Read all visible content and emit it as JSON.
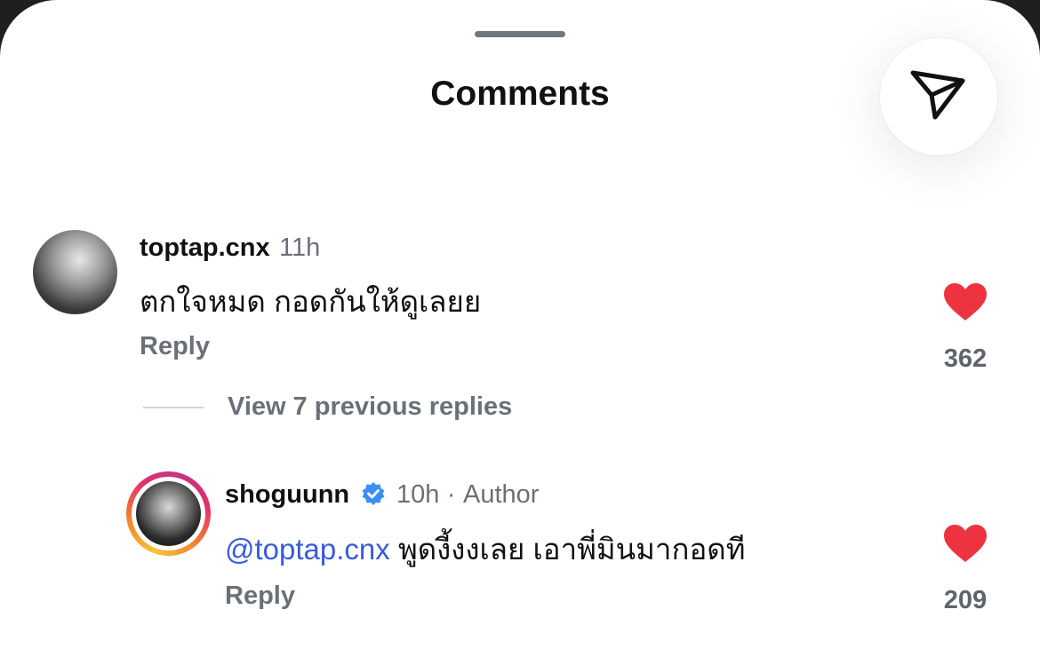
{
  "header": {
    "title": "Comments"
  },
  "share_button": {
    "icon": "paper-plane-icon"
  },
  "comments": [
    {
      "username": "toptap.cnx",
      "time": "11h",
      "text": "ตกใจหมด กอดกันให้ดูเลยย",
      "reply_label": "Reply",
      "likes": "362"
    },
    {
      "username": "shoguunn",
      "verified": true,
      "time": "10h",
      "separator": "·",
      "role": "Author",
      "mention": "@toptap.cnx",
      "text": "พูดงี้งงเลย เอาพี่มินมากอดที",
      "reply_label": "Reply",
      "likes": "209"
    }
  ],
  "thread": {
    "view_replies_label": "View 7 previous replies"
  },
  "colors": {
    "heart": "#ed3340",
    "mention": "#3b5bdb",
    "verified": "#3a8ff7"
  }
}
